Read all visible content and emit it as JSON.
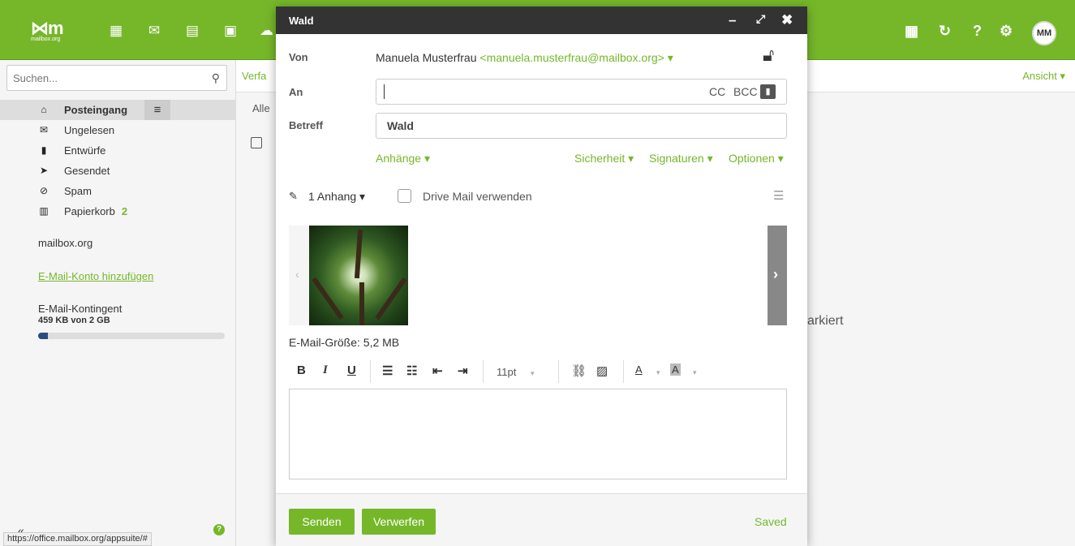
{
  "app": {
    "logo_text": "mailbox.org"
  },
  "topbar": {
    "user_initials": "MM"
  },
  "sidebar": {
    "search_placeholder": "Suchen...",
    "folders": [
      {
        "label": "Posteingang",
        "icon": "inbox-icon"
      },
      {
        "label": "Ungelesen",
        "icon": "envelope-icon"
      },
      {
        "label": "Entwürfe",
        "icon": "file-icon"
      },
      {
        "label": "Gesendet",
        "icon": "paper-plane-icon"
      },
      {
        "label": "Spam",
        "icon": "ban-icon"
      },
      {
        "label": "Papierkorb",
        "icon": "trash-icon",
        "count": "2"
      }
    ],
    "account_name": "mailbox.org",
    "add_account_link": "E-Mail-Konto hinzufügen",
    "quota_label": "E-Mail-Kontingent",
    "quota_value": "459 KB von 2 GB",
    "quota_fraction": 0.02,
    "collapse_label": "«"
  },
  "background": {
    "toolbar_partial": "Verfa",
    "view_label": "Ansicht",
    "filter_partial": "Alle",
    "empty_partial": "arkiert"
  },
  "compose": {
    "title": "Wald",
    "from_label": "Von",
    "from_name": "Manuela Musterfrau",
    "from_email": "<manuela.musterfrau@mailbox.org>",
    "to_label": "An",
    "to_value": "",
    "cc_label": "CC",
    "bcc_label": "BCC",
    "subject_label": "Betreff",
    "subject_value": "Wald",
    "attachments_label": "Anhänge",
    "security_label": "Sicherheit",
    "signatures_label": "Signaturen",
    "options_label": "Optionen",
    "attachment_count": "1 Anhang",
    "drive_mail_label": "Drive Mail verwenden",
    "mail_size": "E-Mail-Größe: 5,2 MB",
    "font_size": "11pt",
    "send_label": "Senden",
    "discard_label": "Verwerfen",
    "saved_label": "Saved"
  },
  "status_bar": {
    "url": "https://office.mailbox.org/appsuite/#"
  }
}
